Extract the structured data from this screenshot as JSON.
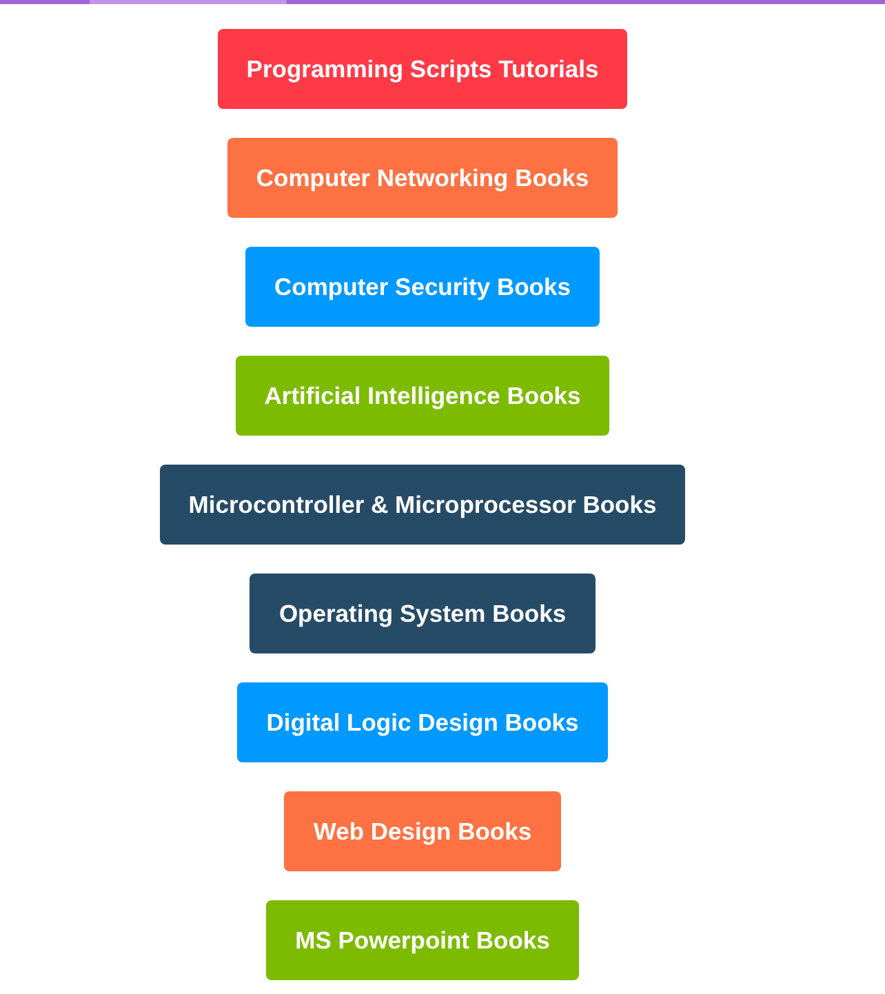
{
  "links": [
    {
      "label": "Programming Scripts Tutorials",
      "color": "#ff3a47"
    },
    {
      "label": "Computer Networking Books",
      "color": "#fd7142"
    },
    {
      "label": "Computer Security Books",
      "color": "#0099ff"
    },
    {
      "label": "Artificial Intelligence Books",
      "color": "#7cbb00"
    },
    {
      "label": "Microcontroller & Microprocessor Books",
      "color": "#264b66"
    },
    {
      "label": "Operating System Books",
      "color": "#264b66"
    },
    {
      "label": "Digital Logic Design Books",
      "color": "#0099ff"
    },
    {
      "label": "Web Design Books",
      "color": "#fd7142"
    },
    {
      "label": "MS Powerpoint Books",
      "color": "#7cbb00"
    }
  ]
}
